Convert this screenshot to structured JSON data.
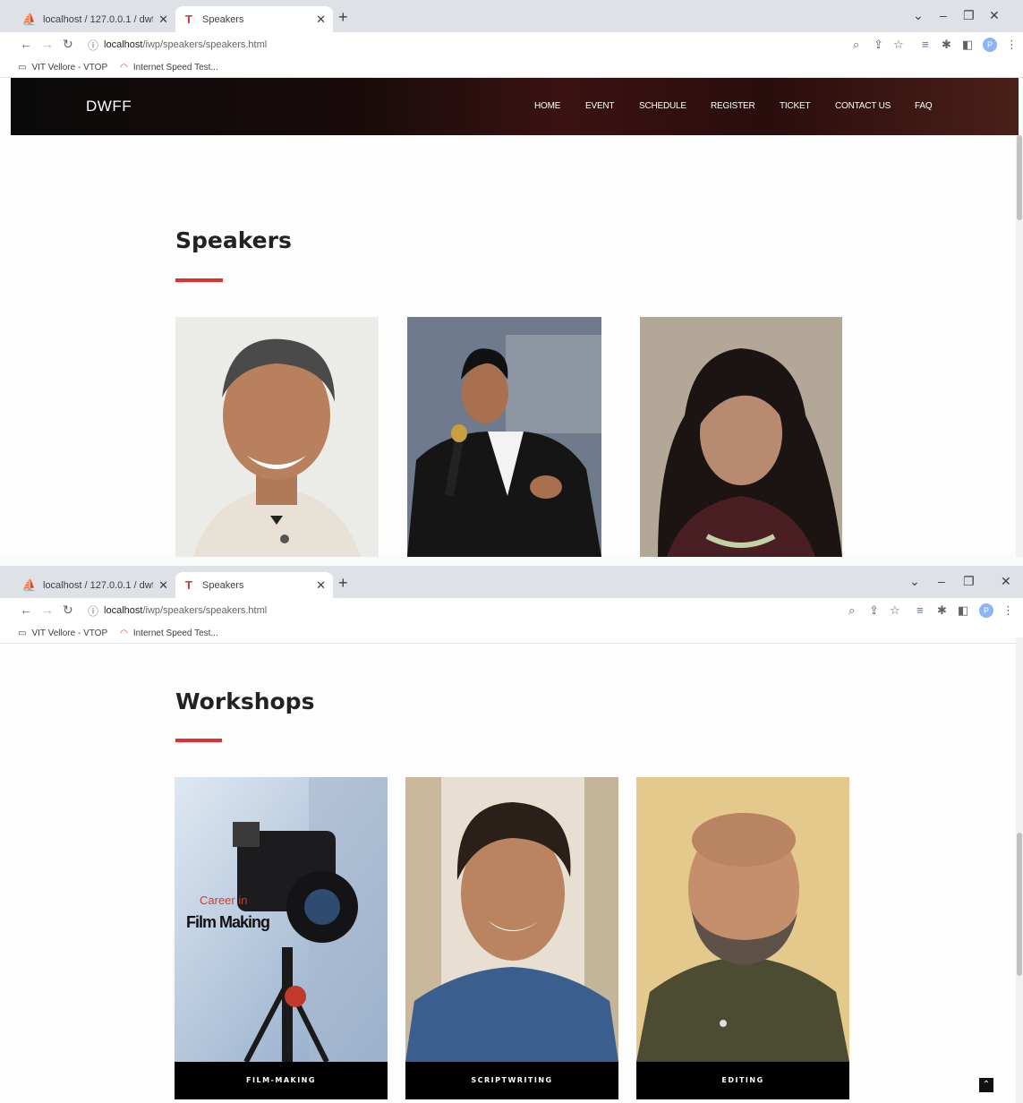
{
  "browser": {
    "tabs": [
      {
        "title": "localhost / 127.0.0.1 / dwff / ticke",
        "icon": "phpmyadmin-icon",
        "active": false
      },
      {
        "title": "Speakers",
        "icon": "t-logo-icon",
        "active": true
      }
    ],
    "url_host": "localhost",
    "url_path": "/iwp/speakers/speakers.html",
    "bookmarks": [
      {
        "label": "VIT Vellore - VTOP",
        "icon": "bookmark-site-icon"
      },
      {
        "label": "Internet Speed Test...",
        "icon": "speedometer-icon"
      }
    ],
    "profile_initial": "P"
  },
  "site": {
    "logo": "DWFF",
    "nav": [
      "HOME",
      "EVENT",
      "SCHEDULE",
      "REGISTER",
      "TICKET",
      "CONTACT US",
      "FAQ"
    ]
  },
  "speakers": {
    "heading": "Speakers",
    "cards": [
      {
        "photo": "speaker-1-photo"
      },
      {
        "photo": "speaker-2-photo"
      },
      {
        "photo": "speaker-3-photo"
      }
    ]
  },
  "workshops": {
    "heading": "Workshops",
    "cards": [
      {
        "caption": "FILM-MAKING",
        "poster_line1": "Career in",
        "poster_line2": "Film Making"
      },
      {
        "caption": "SCRIPTWRITING"
      },
      {
        "caption": "EDITING"
      }
    ]
  },
  "colors": {
    "accent": "#e12e2e",
    "caption_bg": "#000000"
  }
}
